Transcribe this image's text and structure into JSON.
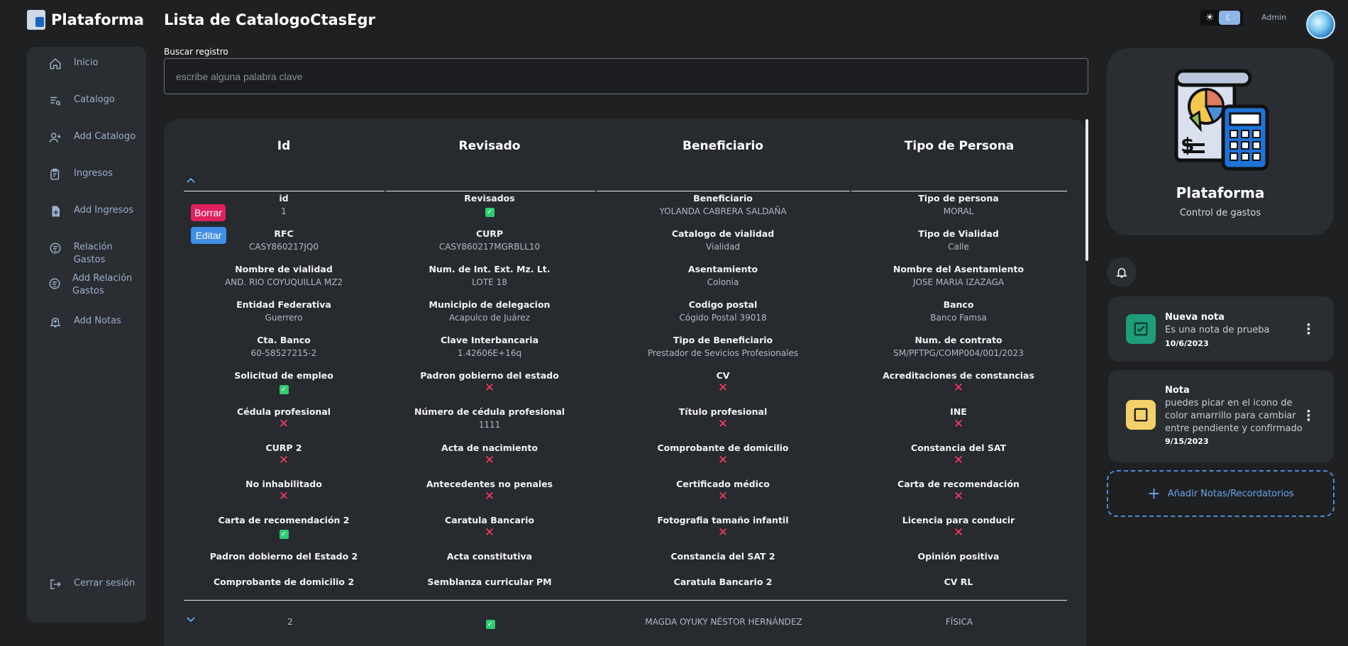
{
  "app": {
    "brand": "Plataforma",
    "page_title": "Lista de CatalogoCtasEgr"
  },
  "header": {
    "user": "Admin",
    "sun_icon": "☀",
    "moon_icon": "☾"
  },
  "sidebar": {
    "items": [
      {
        "label": "Inicio",
        "icon": "home-icon"
      },
      {
        "label": "Catalogo",
        "icon": "catalog-icon"
      },
      {
        "label": "Add Catalogo",
        "icon": "add-user-icon"
      },
      {
        "label": "Ingresos",
        "icon": "clipboard-icon"
      },
      {
        "label": "Add Ingresos",
        "icon": "add-file-icon"
      },
      {
        "label": "Relación Gastos",
        "icon": "money-icon"
      },
      {
        "label": "Add Relación Gastos",
        "icon": "money-add-icon"
      },
      {
        "label": "Add Notas",
        "icon": "bell-add-icon"
      }
    ],
    "logout": "Cerrar sesión"
  },
  "search": {
    "label": "Buscar registro",
    "placeholder": "escribe alguna palabra clave",
    "value": ""
  },
  "table": {
    "columns": [
      "Id",
      "Revisado",
      "Beneficiario",
      "Tipo de Persona"
    ],
    "actions": {
      "delete": "Borrar",
      "edit": "Editar"
    },
    "expanded": {
      "rows": [
        [
          {
            "l": "id",
            "v": "1"
          },
          {
            "l": "Revisados",
            "s": "ok"
          },
          {
            "l": "Beneficiario",
            "v": "YOLANDA CABRERA SALDAÑA"
          },
          {
            "l": "Tipo de persona",
            "v": "MORAL"
          }
        ],
        [
          {
            "l": "RFC",
            "v": "CASY860217JQ0"
          },
          {
            "l": "CURP",
            "v": "CASY860217MGRBLL10"
          },
          {
            "l": "Catalogo de vialidad",
            "v": "Vialidad"
          },
          {
            "l": "Tipo de Vialidad",
            "v": "Calle"
          }
        ],
        [
          {
            "l": "Nombre de vialidad",
            "v": "AND. RIO COYUQUILLA MZ2"
          },
          {
            "l": "Num. de Int. Ext. Mz. Lt.",
            "v": "LOTE 18"
          },
          {
            "l": "Asentamiento",
            "v": "Colonia"
          },
          {
            "l": "Nombre del Asentamiento",
            "v": "JOSE MARIA IZAZAGA"
          }
        ],
        [
          {
            "l": "Entidad Federativa",
            "v": "Guerrero"
          },
          {
            "l": "Municipio de delegacion",
            "v": "Acapulco de Juárez"
          },
          {
            "l": "Codigo postal",
            "v": "Cógido Postal 39018"
          },
          {
            "l": "Banco",
            "v": "Banco Famsa"
          }
        ],
        [
          {
            "l": "Cta. Banco",
            "v": "60-58527215-2"
          },
          {
            "l": "Clave Interbancaria",
            "v": "1.42606E+16q"
          },
          {
            "l": "Tipo de Beneficiario",
            "v": "Prestador de Sevicios Profesionales"
          },
          {
            "l": "Num. de contrato",
            "v": "SM/PFTPG/COMP004/001/2023"
          }
        ],
        [
          {
            "l": "Solicitud de empleo",
            "s": "ok"
          },
          {
            "l": "Padron gobierno del estado",
            "s": "no"
          },
          {
            "l": "CV",
            "s": "no"
          },
          {
            "l": "Acreditaciones de constancias",
            "s": "no"
          }
        ],
        [
          {
            "l": "Cédula profesional",
            "s": "no"
          },
          {
            "l": "Número de cédula profesional",
            "v": "1111"
          },
          {
            "l": "Título profesional",
            "s": "no"
          },
          {
            "l": "INE",
            "s": "no"
          }
        ],
        [
          {
            "l": "CURP 2",
            "s": "no"
          },
          {
            "l": "Acta de nacimiento",
            "s": "no"
          },
          {
            "l": "Comprobante de domicilio",
            "s": "no"
          },
          {
            "l": "Constancia del SAT",
            "s": "no"
          }
        ],
        [
          {
            "l": "No inhabilitado",
            "s": "no"
          },
          {
            "l": "Antecedentes no penales",
            "s": "no"
          },
          {
            "l": "Certificado médico",
            "s": "no"
          },
          {
            "l": "Carta de recomendación",
            "s": "no"
          }
        ],
        [
          {
            "l": "Carta de recomendación 2",
            "s": "ok"
          },
          {
            "l": "Caratula Bancario",
            "s": "no"
          },
          {
            "l": "Fotografia tamaño infantil",
            "s": "no"
          },
          {
            "l": "Licencia para conducir",
            "s": "no"
          }
        ],
        [
          {
            "l": "Padron dobierno del Estado 2"
          },
          {
            "l": "Acta constitutiva"
          },
          {
            "l": "Constancia del SAT 2"
          },
          {
            "l": "Opinión positiva"
          }
        ],
        [
          {
            "l": "Comprobante de domicilio 2"
          },
          {
            "l": "Semblanza curricular PM"
          },
          {
            "l": "Caratula Bancario 2"
          },
          {
            "l": "CV RL"
          }
        ]
      ]
    },
    "second_row": {
      "id": "2",
      "revisado": "ok",
      "beneficiario": "MAGDA OYUKY NÉSTOR HERNÁNDEZ",
      "tipo": "FÍSICA"
    }
  },
  "panel": {
    "title": "Plataforma",
    "subtitle": "Control de gastos",
    "notes": [
      {
        "title": "Nueva nota",
        "body": "Es una nota de prueba",
        "date": "10/6/2023",
        "status": "confirmed",
        "color": "#1f9d7a"
      },
      {
        "title": "Nota",
        "body": "puedes picar en el icono de color amarrillo para cambiar entre pendiente y confirmado",
        "date": "9/15/2023",
        "status": "pending",
        "color": "#f2d06b"
      }
    ],
    "add_note": "Añadir Notas/Recordatorios"
  },
  "colors": {
    "background": "#1e2022",
    "card": "#2a2d31",
    "accent": "#4d8fd6",
    "delete": "#e0215f",
    "edit": "#3f8ee6",
    "ok": "#2ecc71",
    "no": "#ff3a63"
  }
}
